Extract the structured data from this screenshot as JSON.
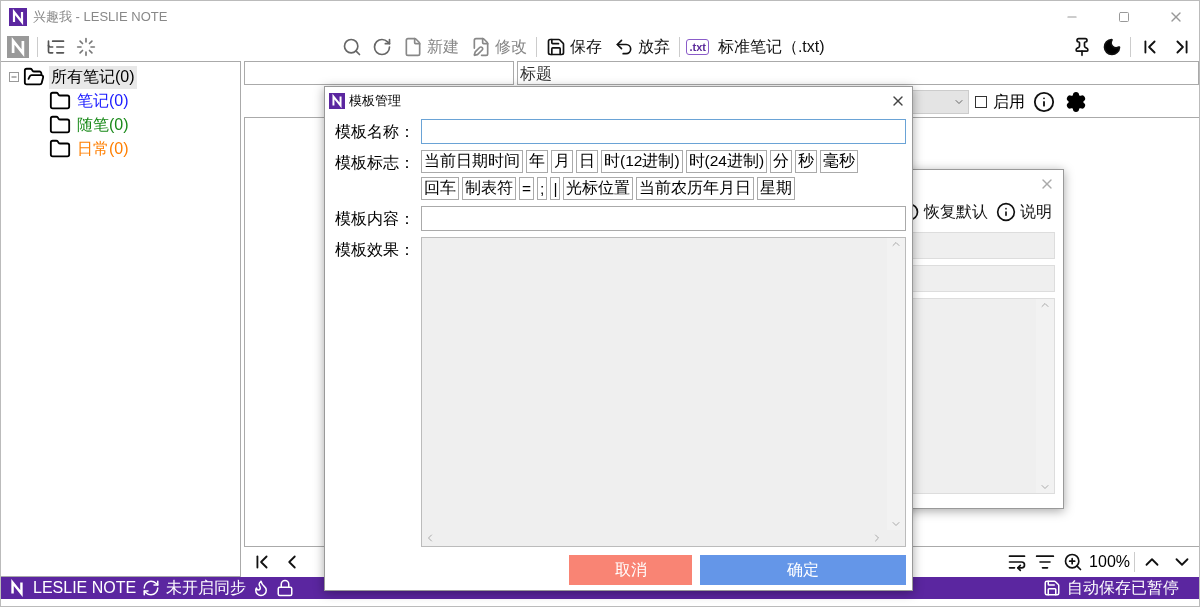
{
  "window": {
    "title": "兴趣我 - LESLIE NOTE"
  },
  "toolbar": {
    "actions": [
      {
        "kind": "new",
        "label": "新建",
        "disabled": true
      },
      {
        "kind": "edit",
        "label": "修改",
        "disabled": true
      },
      {
        "kind": "save",
        "label": "保存",
        "disabled": false
      },
      {
        "kind": "discard",
        "label": "放弃",
        "disabled": false
      }
    ],
    "note_type": {
      "badge": ".txt",
      "label": "标准笔记（.txt)"
    }
  },
  "tree": {
    "label": "所有笔记(0)",
    "expanded": true,
    "selected": true,
    "children": [
      {
        "label": "笔记(0)",
        "color": "#1a1aff",
        "selected": false
      },
      {
        "label": "随笔(0)",
        "color": "#1a8a1a",
        "selected": false
      },
      {
        "label": "日常(0)",
        "color": "#ff7f00",
        "selected": false
      }
    ]
  },
  "title_header": "标题",
  "filter": {
    "label": "启用",
    "checked": false
  },
  "zoom": "100%",
  "back_dialog": {
    "buttons": [
      {
        "kind": "restore",
        "label": "恢复默认"
      },
      {
        "kind": "help",
        "label": "说明"
      }
    ]
  },
  "dialog": {
    "title": "模板管理",
    "name_label": "模板名称：",
    "flag_label": "模板标志：",
    "tag_rows": [
      [
        "当前日期时间",
        "年",
        "月",
        "日",
        "时(12进制)",
        "时(24进制)",
        "分",
        "秒",
        "毫秒"
      ],
      [
        "回车",
        "制表符",
        "=",
        ";",
        "|",
        "光标位置",
        "当前农历年月日",
        "星期"
      ]
    ],
    "content_label": "模板内容：",
    "effect_label": "模板效果：",
    "buttons": [
      {
        "kind": "cancel",
        "label": "取消"
      },
      {
        "kind": "ok",
        "label": "确定"
      }
    ]
  },
  "status_bar": {
    "app": "LESLIE NOTE",
    "sync": "未开启同步",
    "autosave": "自动保存已暂停"
  }
}
